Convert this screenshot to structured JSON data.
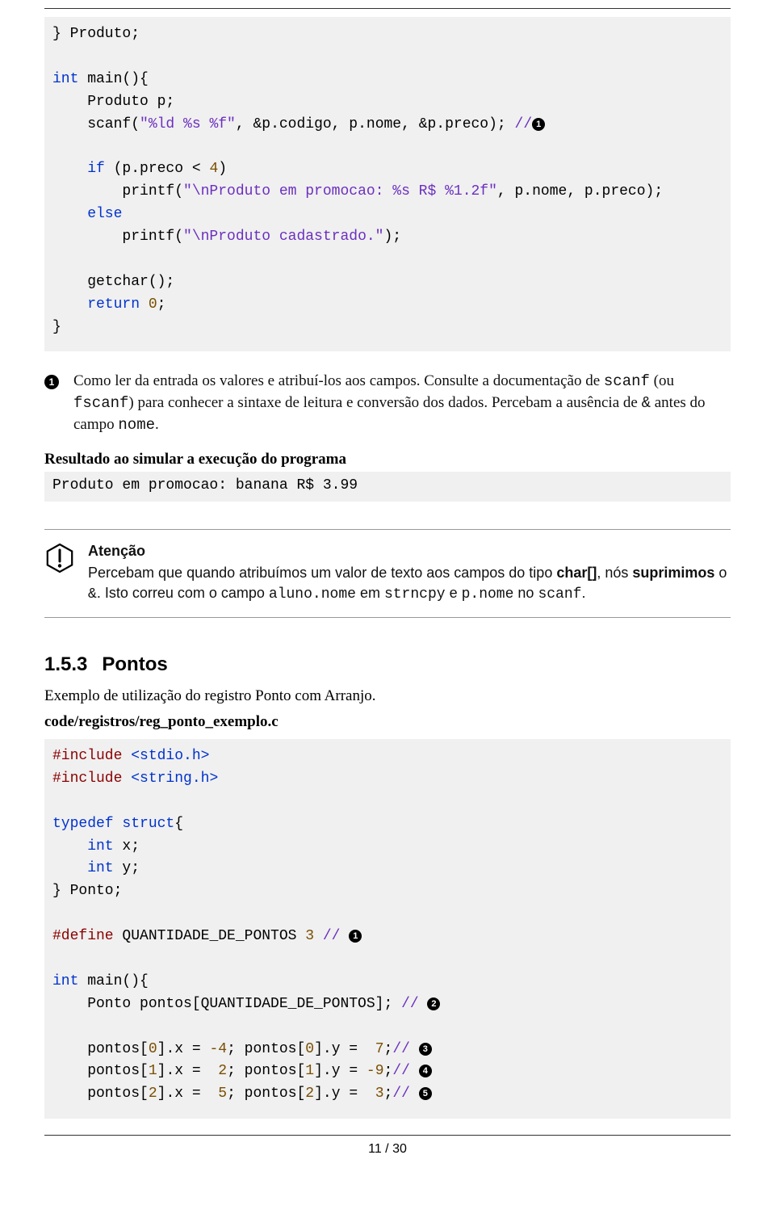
{
  "code1": {
    "l1": "} Produto;",
    "l2": "int",
    "l2b": " main(){",
    "l3": "    Produto p;",
    "l4a": "    scanf(",
    "l4s": "\"%ld %s %f\"",
    "l4b": ", &p.codigo, p.nome, &p.preco); ",
    "l4c": "//",
    "m1": "1",
    "l5": "    if",
    "l5b": " (p.preco < ",
    "l5n": "4",
    "l5c": ")",
    "l6a": "        printf(",
    "l6s": "\"\\nProduto em promocao: %s R$ %1.2f\"",
    "l6b": ", p.nome, p.preco);",
    "l7": "    else",
    "l8a": "        printf(",
    "l8s": "\"\\nProduto cadastrado.\"",
    "l8b": ");",
    "l9": "    getchar();",
    "l10a": "    return",
    "l10b": " ",
    "l10n": "0",
    "l10c": ";",
    "l11": "}"
  },
  "callout1": {
    "marker": "1",
    "textA": "Como ler da entrada os valores e atribuí-los aos campos. Consulte a documentação de ",
    "scanf": "scanf",
    "textB": " (ou ",
    "fscanf": "fscanf",
    "textC": ") para conhecer a sintaxe de leitura e conversão dos dados. Percebam a ausência de ",
    "amp": "&",
    "textD": " antes do campo ",
    "nome": "nome",
    "textE": "."
  },
  "result": {
    "title": "Resultado ao simular a execução do programa",
    "output": "Produto em promocao: banana R$ 3.99"
  },
  "admon": {
    "title": "Atenção",
    "pA": "Percebam que quando atribuímos um valor de texto aos campos do tipo ",
    "charr": "char[]",
    "pB": ", nós ",
    "supri": "supri­mimos",
    "pC": " o ",
    "amp": "&",
    "pD": ". Isto correu com o campo ",
    "aluno": "aluno.nome",
    "pE": " em ",
    "strncpy": "strncpy",
    "pF": " e ",
    "pnome": "p.nome",
    "pG": " no ",
    "scanf": "scanf",
    "pH": "."
  },
  "section": {
    "num": "1.5.3",
    "title": "Pontos",
    "intro": "Exemplo de utilização do registro Ponto com Arranjo.",
    "file": "code/registros/reg_ponto_exemplo.c"
  },
  "code2": {
    "inc": "#include",
    "h1": " <stdio.h>",
    "h2": " <string.h>",
    "td": "typedef struct",
    "tdb": "{",
    "ix": "    int",
    "xb": " x;",
    "iy": "    int",
    "yb": " y;",
    "close": "} Ponto;",
    "def": "#define",
    "defname": " QUANTIDADE_DE_PONTOS ",
    "defv": "3",
    "defc": " // ",
    "m1": "1",
    "mainkw": "int",
    "mainb": " main(){",
    "decl": "    Ponto pontos[QUANTIDADE_DE_PONTOS]; ",
    "declc": "// ",
    "m2": "2",
    "r0a": "    pontos[",
    "r0i": "0",
    "r0b": "].x = ",
    "r0xv": "-4",
    "r0c": "; pontos[",
    "r0i2": "0",
    "r0d": "].y =  ",
    "r0yv": "7",
    "r0e": ";",
    "r0f": "// ",
    "m3": "3",
    "r1a": "    pontos[",
    "r1i": "1",
    "r1b": "].x =  ",
    "r1xv": "2",
    "r1c": "; pontos[",
    "r1i2": "1",
    "r1d": "].y = ",
    "r1yv": "-9",
    "r1e": ";",
    "r1f": "// ",
    "m4": "4",
    "r2a": "    pontos[",
    "r2i": "2",
    "r2b": "].x =  ",
    "r2xv": "5",
    "r2c": "; pontos[",
    "r2i2": "2",
    "r2d": "].y =  ",
    "r2yv": "3",
    "r2e": ";",
    "r2f": "// ",
    "m5": "5"
  },
  "footer": "11 / 30"
}
